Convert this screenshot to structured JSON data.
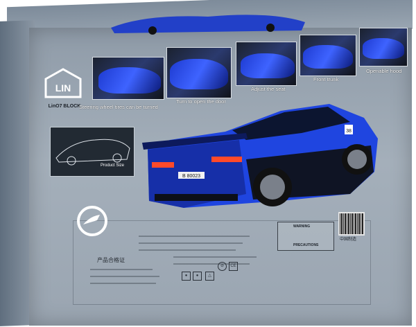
{
  "brand": {
    "logo_letters": "LIN",
    "name": "LinO7 BLOCK"
  },
  "features": [
    {
      "caption": "Steering wheel tires can be turned"
    },
    {
      "caption": "Turn to open the door"
    },
    {
      "caption": "Adjust the seat"
    },
    {
      "caption": "Front trunk"
    },
    {
      "caption": "Openable hood"
    }
  ],
  "product_size_label": "Product Size",
  "car": {
    "plate": "B 80023",
    "side_number": "38"
  },
  "certificate": {
    "title": "产品合格证",
    "made_in": "中国制造",
    "warning": "WARNING",
    "precautions": "PRECAUTIONS"
  },
  "colors": {
    "car_blue": "#1f45e0",
    "box_grey": "#9aa6b2",
    "box_dark": "#5f6e7e"
  }
}
